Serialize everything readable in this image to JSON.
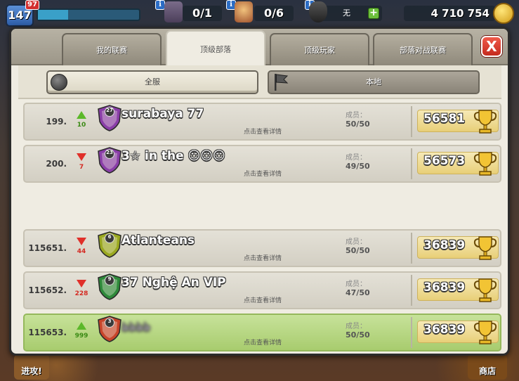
{
  "hud": {
    "level": "147",
    "level_badge": "97",
    "counter_1": "0/1",
    "counter_2": "0/6",
    "shield_text": "无",
    "gold": "4 710 754",
    "attack_label": "进攻!",
    "shop_label": "商店"
  },
  "tabs": [
    {
      "label": "我的联赛",
      "active": false
    },
    {
      "label": "顶级部落",
      "active": true
    },
    {
      "label": "顶级玩家",
      "active": false
    },
    {
      "label": "部落对战联赛",
      "active": false
    }
  ],
  "close_label": "X",
  "scope": {
    "global_label": "全服",
    "local_label": "本地"
  },
  "rows_common": {
    "details_label": "点击查看详情",
    "members_label": "成员："
  },
  "rows": [
    {
      "rank": "199.",
      "trend": "up",
      "change": "10",
      "badge_level": "27",
      "badge_color": "#8a3ea8",
      "name": "surabaya 77",
      "members": "50/50",
      "trophies": "56581",
      "mine": false
    },
    {
      "rank": "200.",
      "trend": "down",
      "change": "7",
      "badge_level": "23",
      "badge_color": "#8a3ea8",
      "name": "3☆ in the ☺☺☺",
      "members": "49/50",
      "trophies": "56573",
      "mine": false
    },
    {
      "rank": "115651.",
      "trend": "down",
      "change": "44",
      "badge_level": "6",
      "badge_color": "#9aa820",
      "name": "Atlanteans",
      "members": "50/50",
      "trophies": "36839",
      "mine": false
    },
    {
      "rank": "115652.",
      "trend": "down",
      "change": "228",
      "badge_level": "9",
      "badge_color": "#2e8a3a",
      "name": "37 Nghệ An VIP",
      "members": "47/50",
      "trophies": "36839",
      "mine": false
    },
    {
      "rank": "115653.",
      "trend": "up",
      "change": "999",
      "badge_level": "3",
      "badge_color": "#c8452a",
      "name": "ঌঌঌঌ",
      "members": "50/50",
      "trophies": "36839",
      "mine": true
    }
  ]
}
